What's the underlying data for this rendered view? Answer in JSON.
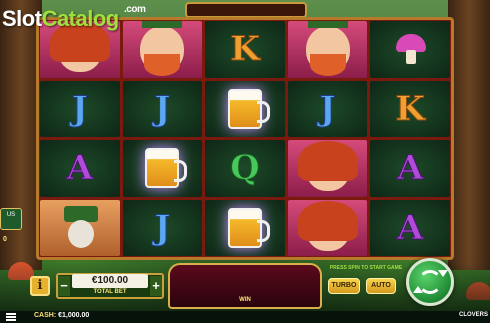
{
  "logo": {
    "slot": "Slot",
    "catalog": "Catalog",
    "com": ".com"
  },
  "side": {
    "label": "US",
    "value": "0"
  },
  "reels": [
    [
      "redhead-woman",
      "leprechaun",
      "K",
      "leprechaun",
      "mushroom"
    ],
    [
      "J",
      "J",
      "beer",
      "J",
      "K"
    ],
    [
      "A",
      "beer",
      "Q",
      "redhead-woman",
      "A"
    ],
    [
      "rabbit",
      "J",
      "beer",
      "redhead-woman",
      "A"
    ]
  ],
  "controls": {
    "info_label": "i",
    "minus_label": "−",
    "plus_label": "+",
    "bet_value": "€100.00",
    "bet_caption": "TOTAL BET",
    "win_caption": "WIN",
    "press_spin": "PRESS SPIN TO START GAME",
    "turbo_label": "TURBO",
    "auto_label": "AUTO"
  },
  "footer": {
    "cash_label": "CASH:",
    "cash_value": "€1,000.00",
    "game_name": "CLOVERS"
  }
}
